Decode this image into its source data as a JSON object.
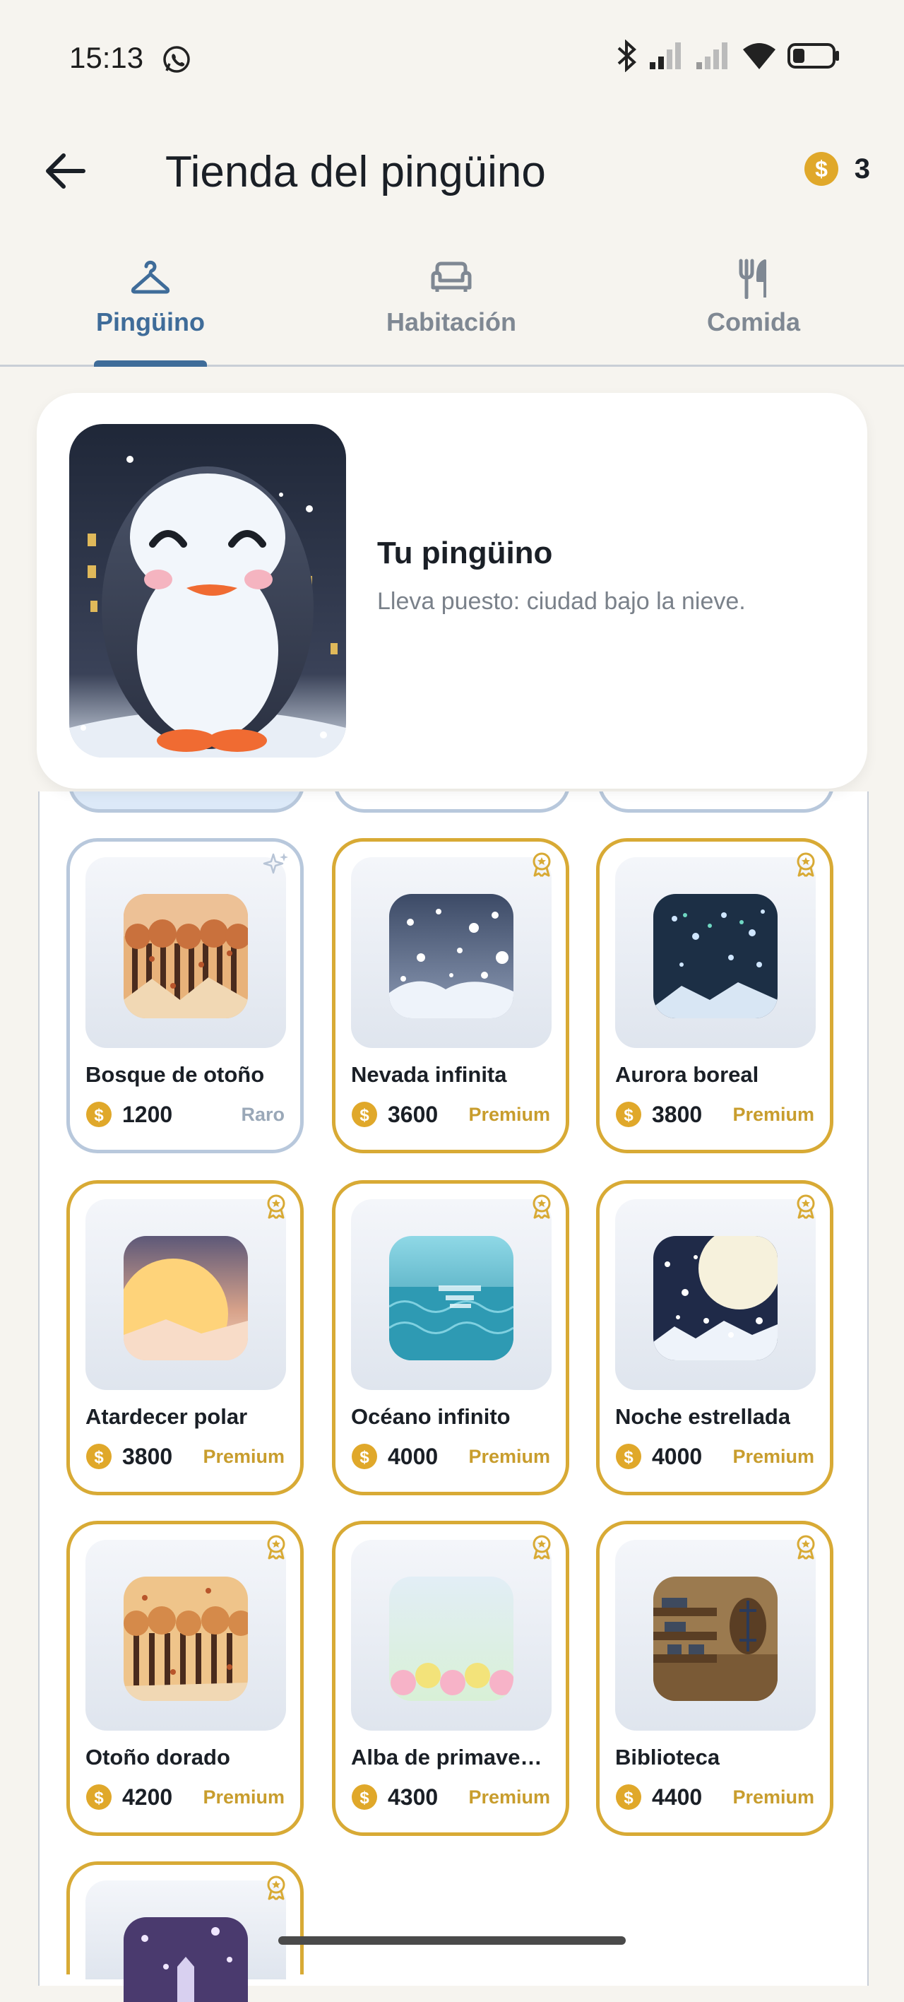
{
  "status_bar": {
    "time": "15:13",
    "icons": [
      "whatsapp-icon",
      "bluetooth-icon",
      "signal-icon",
      "signal-icon",
      "wifi-icon",
      "battery-icon"
    ]
  },
  "header": {
    "title": "Tienda del pingüino",
    "coins": "3"
  },
  "tabs": [
    {
      "label": "Pingüino",
      "icon": "hanger-icon",
      "active": true
    },
    {
      "label": "Habitación",
      "icon": "sofa-icon",
      "active": false
    },
    {
      "label": "Comida",
      "icon": "fork-knife-icon",
      "active": false
    }
  ],
  "preview": {
    "title": "Tu pingüino",
    "subtitle": "Lleva puesto: ciudad bajo la nieve."
  },
  "items": [
    {
      "name": "Bosque de otoño",
      "price": "1200",
      "tier": "Raro",
      "kind": "rare"
    },
    {
      "name": "Nevada infinita",
      "price": "3600",
      "tier": "Premium",
      "kind": "premium"
    },
    {
      "name": "Aurora boreal",
      "price": "3800",
      "tier": "Premium",
      "kind": "premium"
    },
    {
      "name": "Atardecer polar",
      "price": "3800",
      "tier": "Premium",
      "kind": "premium"
    },
    {
      "name": "Océano infinito",
      "price": "4000",
      "tier": "Premium",
      "kind": "premium"
    },
    {
      "name": "Noche estrellada",
      "price": "4000",
      "tier": "Premium",
      "kind": "premium"
    },
    {
      "name": "Otoño dorado",
      "price": "4200",
      "tier": "Premium",
      "kind": "premium"
    },
    {
      "name": "Alba de primave…",
      "price": "4300",
      "tier": "Premium",
      "kind": "premium"
    },
    {
      "name": "Biblioteca",
      "price": "4400",
      "tier": "Premium",
      "kind": "premium"
    }
  ],
  "colors": {
    "accent": "#3f6c99",
    "gold": "#d8aa35",
    "coin": "#e0a82a",
    "background": "#f6f4ef"
  }
}
